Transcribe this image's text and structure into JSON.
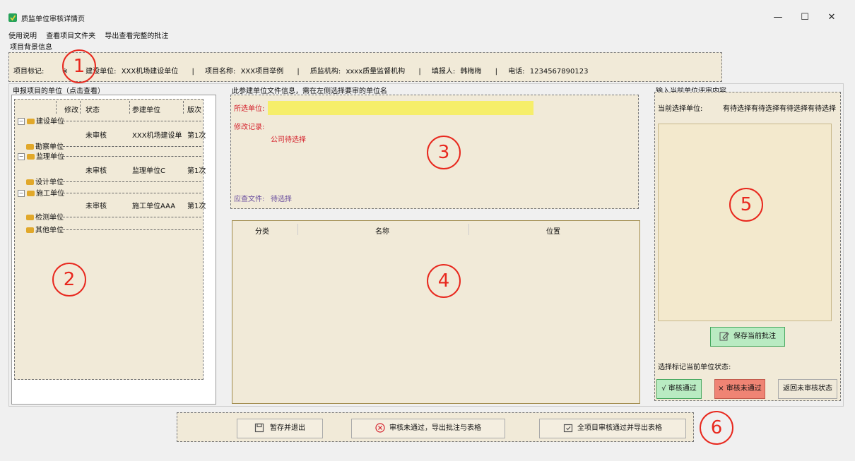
{
  "window": {
    "title": "质监单位审核详情页",
    "minimize": "—",
    "maximize": "☐",
    "close": "✕"
  },
  "menu": [
    "使用说明",
    "查看项目文件夹",
    "导出查看完整的批注"
  ],
  "project_section_title": "项目背景信息",
  "project_info": {
    "mark_label": "项目标记:",
    "mark_value": "※",
    "builder_label": "建设单位:",
    "builder_value": "XXX机场建设单位",
    "name_label": "项目名称:",
    "name_value": "XXX项目举例",
    "agency_label": "质监机构:",
    "agency_value": "xxxx质量监督机构",
    "filler_label": "填报人:",
    "filler_value": "韩梅梅",
    "phone_label": "电话:",
    "phone_value": "1234567890123",
    "separator": "|"
  },
  "left_section_title": "申报项目的单位（点击查看）",
  "tree": {
    "columns": [
      "修改",
      "状态",
      "参建单位",
      "版次"
    ],
    "groups": [
      {
        "label": "建设单位",
        "rows": [
          {
            "status": "未审核",
            "unit": "XXX机场建设单",
            "version": "第1次"
          }
        ]
      },
      {
        "label": "勘察单位",
        "rows": []
      },
      {
        "label": "监理单位",
        "rows": [
          {
            "status": "未审核",
            "unit": "监理单位C",
            "version": "第1次"
          }
        ]
      },
      {
        "label": "设计单位",
        "rows": []
      },
      {
        "label": "施工单位",
        "rows": [
          {
            "status": "未审核",
            "unit": "施工单位AAA",
            "version": "第1次"
          }
        ]
      },
      {
        "label": "检测单位",
        "rows": []
      },
      {
        "label": "其他单位",
        "rows": []
      }
    ]
  },
  "middle_section_title": "此参建单位文件信息，需在左侧选择要审的单位名",
  "file_info": {
    "selected_unit_label": "所选单位:",
    "modify_label": "修改记录:",
    "modify_value": "公司待选择",
    "review_label": "应查文件:",
    "review_value": "待选择"
  },
  "file_table": {
    "columns": [
      "分类",
      "名称",
      "位置"
    ]
  },
  "right_section_title": "输入当前单位评审内容",
  "review": {
    "current_unit_label": "当前选择单位:",
    "current_unit_value": "有待选择有待选择有待选择有待选择",
    "save_button": "保存当前批注",
    "status_label": "选择标记当前单位状态:",
    "pass_button": "√ 审核通过",
    "fail_button": "× 审核未通过",
    "reset_button": "返回未审核状态"
  },
  "bottom_buttons": {
    "save_exit": "暂存并退出",
    "fail_export": "审核未通过，导出批注与表格",
    "pass_export": "全项目审核通过并导出表格"
  },
  "annotations": [
    "1",
    "2",
    "3",
    "4",
    "5",
    "6"
  ],
  "colors": {
    "beige": "#f1ead8",
    "highlight_yellow": "#f6ee6a",
    "annotation_red": "#e8281e",
    "pass_green": "#b9ebc2",
    "fail_red": "#ef8474"
  }
}
